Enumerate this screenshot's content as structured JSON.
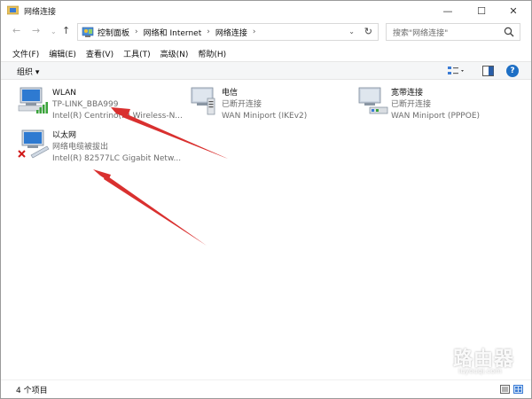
{
  "window": {
    "title": "网络连接",
    "minimize_glyph": "—",
    "maximize_glyph": "☐",
    "close_glyph": "✕"
  },
  "address": {
    "back_glyph": "←",
    "forward_glyph": "→",
    "recent_glyph": "⌄",
    "up_glyph": "↑",
    "crumbs": [
      "控制面板",
      "网络和 Internet",
      "网络连接"
    ],
    "separator": "›",
    "dropdown_glyph": "⌄",
    "refresh_glyph": "↻",
    "search_placeholder": "搜索\"网络连接\"",
    "icons": {
      "location": "control-panel-icon",
      "search": "search-icon"
    }
  },
  "menu": {
    "items": [
      "文件(F)",
      "编辑(E)",
      "查看(V)",
      "工具(T)",
      "高级(N)",
      "帮助(H)"
    ]
  },
  "command_bar": {
    "organize_label": "组织 ▾",
    "help_glyph": "?"
  },
  "connections": [
    {
      "name": "WLAN",
      "status": "TP-LINK_BBA999",
      "device": "Intel(R) Centrino(R) Wireless-N...",
      "icon": "wifi-adapter-icon"
    },
    {
      "name": "电信",
      "status": "已断开连接",
      "device": "WAN Miniport (IKEv2)",
      "icon": "vpn-adapter-icon"
    },
    {
      "name": "宽带连接",
      "status": "已断开连接",
      "device": "WAN Miniport (PPPOE)",
      "icon": "broadband-adapter-icon"
    },
    {
      "name": "以太网",
      "status": "网络电缆被拔出",
      "device": "Intel(R) 82577LC Gigabit Netw...",
      "icon": "ethernet-adapter-icon"
    }
  ],
  "status_bar": {
    "count": "4 个项目"
  },
  "watermark": {
    "main": "路由器",
    "sub": "luyouqi.com"
  },
  "colors": {
    "accent": "#1e6fc5",
    "arrow": "#d9302f",
    "disconnected_x": "#d11a1a",
    "signal_green": "#3aa33a"
  }
}
